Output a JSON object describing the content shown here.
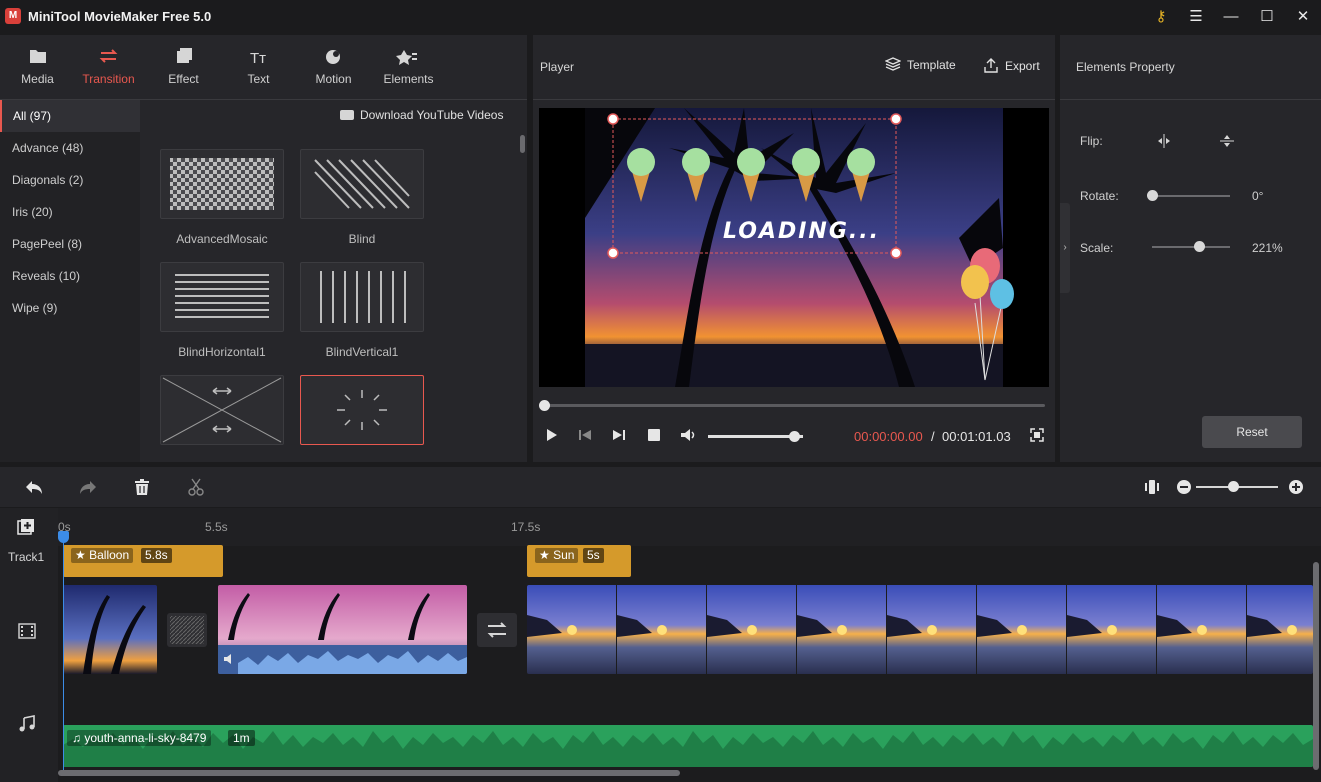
{
  "app": {
    "title": "MiniTool MovieMaker Free 5.0",
    "logo_text": "M"
  },
  "tabs": [
    {
      "label": "Media",
      "icon": "folder-icon"
    },
    {
      "label": "Transition",
      "icon": "transition-arrows-icon",
      "active": true
    },
    {
      "label": "Effect",
      "icon": "effect-icon"
    },
    {
      "label": "Text",
      "icon": "text-icon"
    },
    {
      "label": "Motion",
      "icon": "motion-icon"
    },
    {
      "label": "Elements",
      "icon": "elements-icon"
    }
  ],
  "categories": [
    {
      "label": "All (97)",
      "active": true
    },
    {
      "label": "Advance (48)"
    },
    {
      "label": "Diagonals (2)"
    },
    {
      "label": "Iris (20)"
    },
    {
      "label": "PagePeel (8)"
    },
    {
      "label": "Reveals (10)"
    },
    {
      "label": "Wipe (9)"
    }
  ],
  "download_link": "Download YouTube Videos",
  "transitions": [
    {
      "name": "AdvancedMosaic",
      "icon": "mosaic-icon"
    },
    {
      "name": "Blind",
      "icon": "diagonal-lines-icon"
    },
    {
      "name": "BlindHorizontal1",
      "icon": "horizontal-lines-icon"
    },
    {
      "name": "BlindVertical1",
      "icon": "vertical-lines-icon"
    },
    {
      "name": "",
      "icon": "x-arrows-icon"
    },
    {
      "name": "",
      "icon": "burst-icon",
      "selected": true
    }
  ],
  "player": {
    "title": "Player",
    "template_label": "Template",
    "export_label": "Export",
    "overlay_text": "LOADING...",
    "time_current": "00:00:00.00",
    "time_separator": "/",
    "time_total": "00:01:01.03",
    "volume": 0.9
  },
  "properties": {
    "title": "Elements Property",
    "flip_label": "Flip:",
    "rotate_label": "Rotate:",
    "rotate_value": "0°",
    "rotate_fraction": 0.0,
    "scale_label": "Scale:",
    "scale_value": "221%",
    "scale_fraction": 0.6,
    "reset_label": "Reset"
  },
  "timeline": {
    "ticks": [
      "0s",
      "5.5s",
      "17.5s"
    ],
    "track1_label": "Track1",
    "element_clips": [
      {
        "name": "Balloon",
        "duration": "5.8s"
      },
      {
        "name": "Sun",
        "duration": "5s"
      }
    ],
    "audio": {
      "name": "youth-anna-li-sky-8479",
      "duration": "1m"
    },
    "zoom": 0.45
  },
  "colors": {
    "accent": "#e8584f",
    "element_clip": "#d59a2b",
    "audio_clip": "#2aa15c",
    "playhead": "#3c8ce7"
  }
}
